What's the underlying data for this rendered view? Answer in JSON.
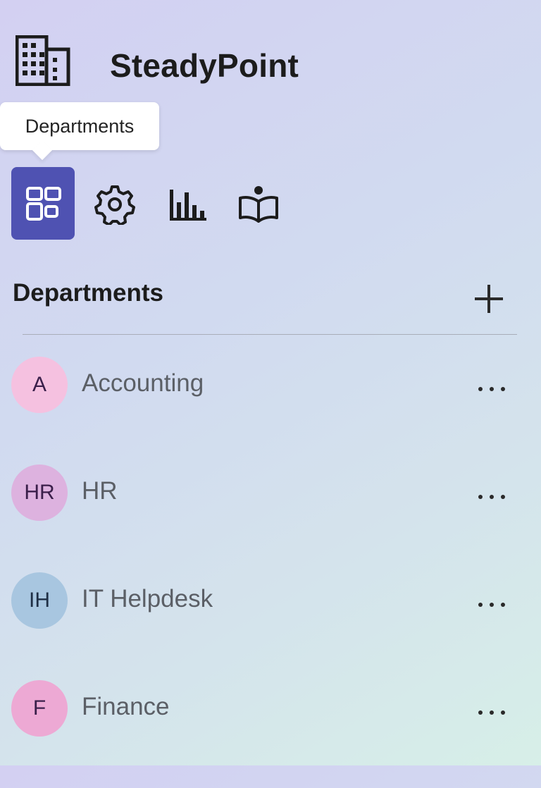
{
  "app": {
    "title": "SteadyPoint",
    "logo_icon": "building-icon"
  },
  "tooltip": {
    "text": "Departments"
  },
  "nav": {
    "items": [
      {
        "icon": "grid-apps-icon",
        "name": "Departments",
        "active": true
      },
      {
        "icon": "gear-icon",
        "name": "Settings",
        "active": false
      },
      {
        "icon": "bar-chart-icon",
        "name": "Reports",
        "active": false
      },
      {
        "icon": "book-reader-icon",
        "name": "Learning",
        "active": false
      }
    ],
    "active_color": "#4f52b2"
  },
  "section": {
    "title": "Departments",
    "add_icon": "plus-icon"
  },
  "departments": [
    {
      "initials": "A",
      "name": "Accounting",
      "avatar_color": "#f5c1e0"
    },
    {
      "initials": "HR",
      "name": "HR",
      "avatar_color": "#ddb2df"
    },
    {
      "initials": "IH",
      "name": "IT Helpdesk",
      "avatar_color": "#a8c6e0"
    },
    {
      "initials": "F",
      "name": "Finance",
      "avatar_color": "#eda9d4"
    }
  ],
  "more_icon": "more-horizontal-icon"
}
